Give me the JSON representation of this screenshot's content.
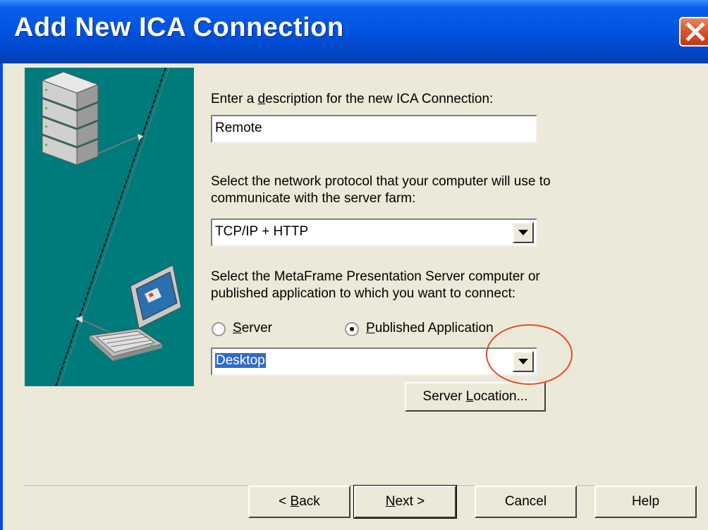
{
  "window": {
    "title": "Add New ICA Connection"
  },
  "description": {
    "prompt_pre": "Enter a ",
    "prompt_accel": "d",
    "prompt_post": "escription for the new ICA Connection:",
    "value": "Remote"
  },
  "protocol": {
    "prompt_line1": "Select the network protocol that your computer will use to",
    "prompt_line2": "communicate with the server farm:",
    "selected": "TCP/IP + HTTP"
  },
  "target": {
    "prompt_line1": "Select the MetaFrame Presentation Server computer or",
    "prompt_line2": "published application to which you want to connect:",
    "radio_server_accel": "S",
    "radio_server_rest": "erver",
    "radio_server_checked": false,
    "radio_app_accel": "P",
    "radio_app_rest": "ublished Application",
    "radio_app_checked": true,
    "selected": "Desktop"
  },
  "buttons": {
    "server_location_pre": "Server ",
    "server_location_accel": "L",
    "server_location_post": "ocation...",
    "back_pre": "< ",
    "back_accel": "B",
    "back_post": "ack",
    "next_accel": "N",
    "next_post": "ext >",
    "cancel": "Cancel",
    "help": "Help"
  },
  "colors": {
    "title_bar": "#0054E3",
    "dialog_bg": "#ECE9D8",
    "illustration_bg": "#007B7B",
    "annotation": "#E34A2C"
  },
  "icons": [
    "close-icon",
    "server-stack-icon",
    "laptop-icon",
    "dropdown-arrow-icon"
  ]
}
